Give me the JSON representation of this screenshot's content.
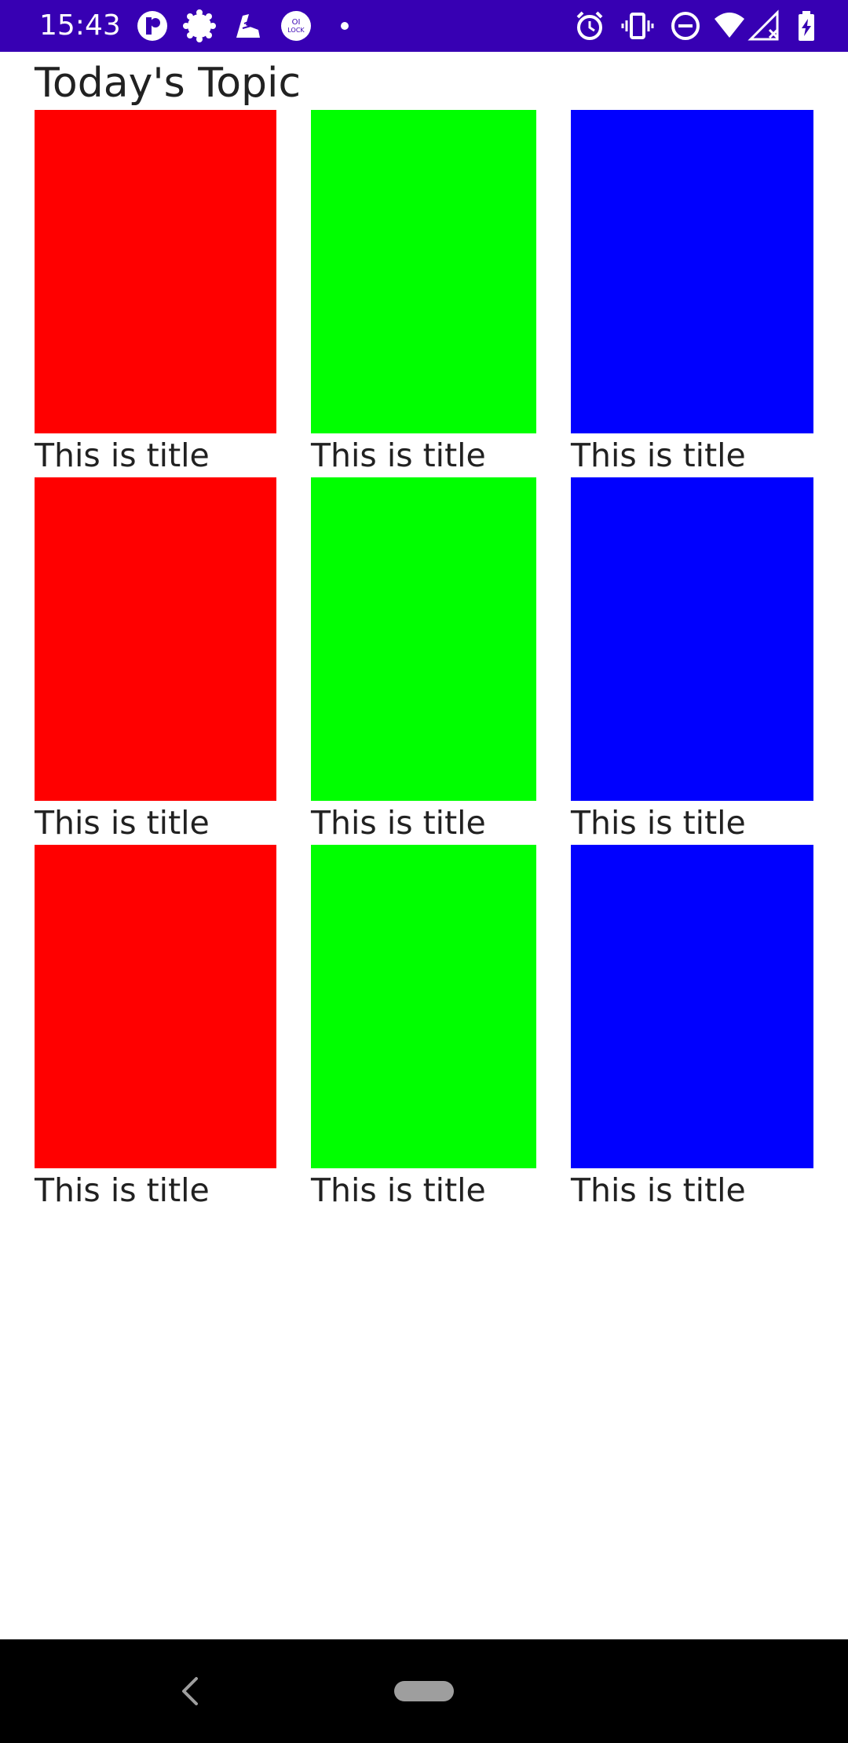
{
  "status_bar": {
    "time": "15:43",
    "background": "#3700b3",
    "left_icons": [
      "app-badge-icon",
      "gear-badge-icon",
      "shoe-icon",
      "oi-lock-icon",
      "dot-icon"
    ],
    "right_icons": [
      "alarm-icon",
      "vibrate-icon",
      "do-not-disturb-icon",
      "wifi-icon",
      "no-signal-icon",
      "battery-charging-icon"
    ]
  },
  "page": {
    "title": "Today's Topic"
  },
  "grid": {
    "columns": 3,
    "rows": 3,
    "colors": [
      "#ff0000",
      "#00ff00",
      "#0000ff"
    ],
    "items": [
      {
        "title": "This is title",
        "color": "#ff0000"
      },
      {
        "title": "This is title",
        "color": "#00ff00"
      },
      {
        "title": "This is title",
        "color": "#0000ff"
      },
      {
        "title": "This is title",
        "color": "#ff0000"
      },
      {
        "title": "This is title",
        "color": "#00ff00"
      },
      {
        "title": "This is title",
        "color": "#0000ff"
      },
      {
        "title": "This is title",
        "color": "#ff0000"
      },
      {
        "title": "This is title",
        "color": "#00ff00"
      },
      {
        "title": "This is title",
        "color": "#0000ff"
      }
    ]
  },
  "nav_bar": {
    "background": "#000000",
    "icons": [
      "back-icon",
      "home-pill-icon"
    ]
  }
}
